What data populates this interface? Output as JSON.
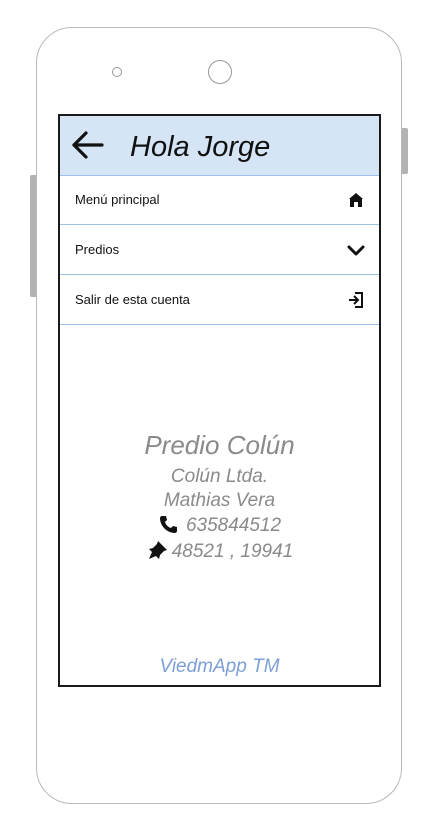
{
  "header": {
    "title": "Hola Jorge",
    "back_icon": "arrow-left-icon"
  },
  "menu": {
    "items": [
      {
        "label": "Menú principal",
        "icon": "home-icon"
      },
      {
        "label": "Predios",
        "icon": "chevron-down-icon"
      },
      {
        "label": "Salir de esta cuenta",
        "icon": "sign-out-icon"
      }
    ]
  },
  "property": {
    "name": "Predio Colún",
    "company": "Colún Ltda.",
    "contact": "Mathias Vera",
    "phone": "635844512",
    "coordinates": "48521 , 19941"
  },
  "footer": {
    "brand": "ViedmApp TM"
  },
  "colors": {
    "header_bg": "#d5e5f5",
    "divider": "#9ec3e6",
    "info_text": "#8a8a8a",
    "brand_text": "#7b9fd6"
  }
}
